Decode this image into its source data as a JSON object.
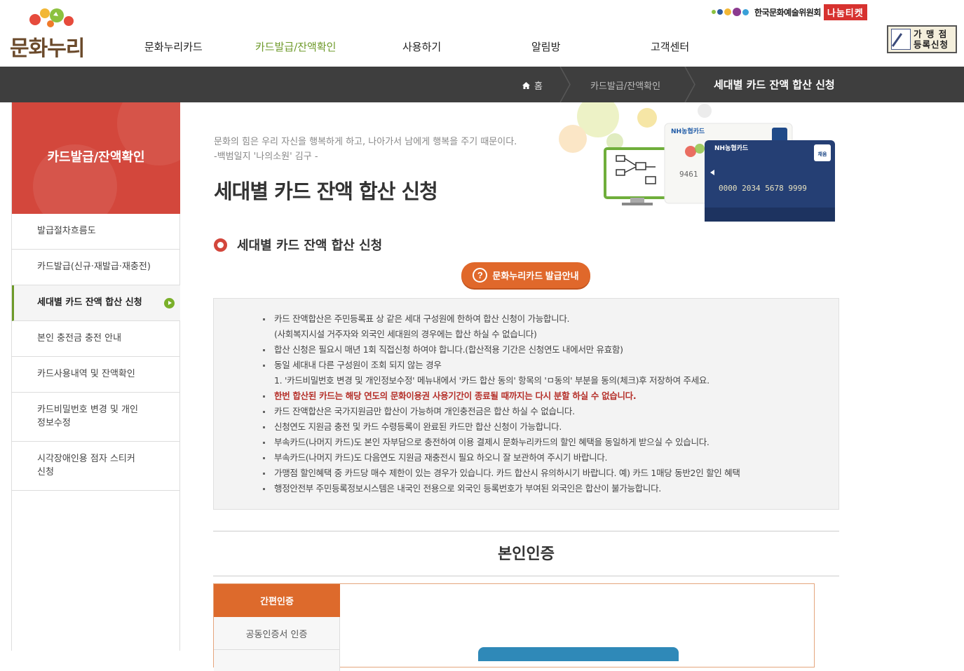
{
  "header": {
    "logo_text": "문화누리",
    "org_name": "한국문화예술위원회",
    "org_badge": "나눔티켓",
    "store_button_line1": "가 맹 점",
    "store_button_line2": "등록신청",
    "nav": [
      {
        "label": "문화누리카드"
      },
      {
        "label": "카드발급/잔액확인"
      },
      {
        "label": "사용하기"
      },
      {
        "label": "알림방"
      },
      {
        "label": "고객센터"
      }
    ]
  },
  "breadcrumb": {
    "home": "홈",
    "level1": "카드발급/잔액확인",
    "current": "세대별 카드 잔액 합산 신청"
  },
  "sidebar": {
    "title": "카드발급/잔액확인",
    "items": [
      {
        "label": "발급절차흐름도"
      },
      {
        "label": "카드발급(신규·재발급·재충전)"
      },
      {
        "label": "세대별 카드 잔액 합산 신청"
      },
      {
        "label": "본인 충전금 충전 안내"
      },
      {
        "label": "카드사용내역 및 잔액확인"
      },
      {
        "label": "카드비밀번호 변경 및 개인\n정보수정"
      },
      {
        "label": "시각장애인용 점자 스티커\n신청"
      }
    ]
  },
  "main": {
    "quote_line1": "문화의 힘은 우리 자신을 행복하게 하고, 나아가서 남에게 행복을 주기 때문이다.",
    "quote_line2": "-백범일지 '나의소원' 김구 -",
    "page_title": "세대별 카드 잔액 합산 신청",
    "section_title": "세대별 카드 잔액 합산 신청",
    "guide_button": "문화누리카드 발급안내",
    "hero": {
      "card_brand": "NH농협카드",
      "card_number": "0000 2034 5678 9999",
      "card_badge": "채움",
      "back_card_number": "9461"
    },
    "notices": [
      {
        "text": "카드 잔액합산은 주민등록표 상 같은 세대 구성원에 한하여 합산 신청이 가능합니다.",
        "type": "normal"
      },
      {
        "text": "(사회복지시설 거주자와 외국인 세대원의 경우에는 합산 하실 수 없습니다)",
        "type": "sub"
      },
      {
        "text": "합산 신청은 필요시 매년 1회 직접신청 하여야 합니다.(합산적용 기간은 신청연도 내에서만 유효함)",
        "type": "normal"
      },
      {
        "text": "동일 세대내 다른 구성원이 조회 되지 않는 경우",
        "type": "normal"
      },
      {
        "text": "1. '카드비밀번호 변경 및 개인정보수정' 메뉴내에서 '카드 합산 동의' 항목의 'ㅁ동의' 부분을 동의(체크)후 저장하여 주세요.",
        "type": "sub"
      },
      {
        "text": "한번 합산된 카드는 해당 연도의 문화이용권 사용기간이 종료될 때까지는 다시 분할 하실 수 없습니다.",
        "type": "warn"
      },
      {
        "text": "카드 잔액합산은 국가지원금만 합산이 가능하며 개인충전금은 합산 하실 수 없습니다.",
        "type": "normal"
      },
      {
        "text": "신청연도 지원금 충전 및 카드 수령등록이 완료된 카드만 합산 신청이 가능합니다.",
        "type": "normal"
      },
      {
        "text": "부속카드(나머지 카드)도 본인 자부담으로 충전하여 이용 결제시 문화누리카드의 할인 혜택을 동일하게 받으실 수 있습니다.",
        "type": "normal"
      },
      {
        "text": "부속카드(나머지 카드)도 다음연도 지원금 재충전시 필요 하오니 잘 보관하여 주시기 바랍니다.",
        "type": "normal"
      },
      {
        "text": "가맹점 할인혜택 중 카드당 매수 제한이 있는 경우가 있습니다. 카드 합산시 유의하시기 바랍니다. 예) 카드 1매당 동반2인 할인 혜택",
        "type": "normal"
      },
      {
        "text": "행정안전부 주민등록정보시스템은 내국인 전용으로 외국인 등록번호가 부여된 외국인은 합산이 불가능합니다.",
        "type": "normal"
      }
    ],
    "auth_title": "본인인증",
    "auth_tabs": [
      {
        "label": "간편인증"
      },
      {
        "label": "공동인증서 인증"
      }
    ]
  },
  "colors": {
    "accent_green": "#6e9a2a",
    "sidebar_red": "#d3473c",
    "button_orange": "#e0682b",
    "bar_dark": "#3e3e3e"
  }
}
